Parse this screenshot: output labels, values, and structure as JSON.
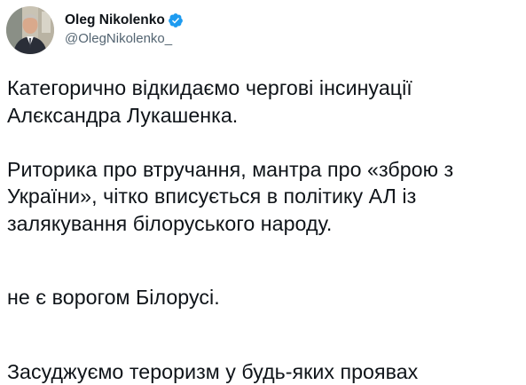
{
  "author": {
    "display_name": "Oleg Nikolenko",
    "handle": "@OlegNikolenko_",
    "verified_icon": "verified-badge-icon",
    "verified_color": "#1d9bf0",
    "avatar_icon": "profile-photo"
  },
  "tweet": {
    "paragraph1": [
      "Категорично відкидаємо чергові інсинуації",
      "Алєксандра Лукашенка."
    ],
    "paragraph2": [
      "Риторика про втручання, мантра про «зброю з",
      "України», чітко вписується в політику АЛ із",
      "залякування білоруського народу."
    ],
    "paragraph3": {
      "emoji": "ukraine-flag-icon",
      "text": "не є ворогом Білорусі."
    },
    "paragraph4": [
      "Засуджуємо тероризм у будь-яких проявах"
    ]
  },
  "colors": {
    "text": "#0f1419",
    "secondary_text": "#536471",
    "flag_blue": "#1f7bd8",
    "flag_yellow": "#f9d138"
  }
}
